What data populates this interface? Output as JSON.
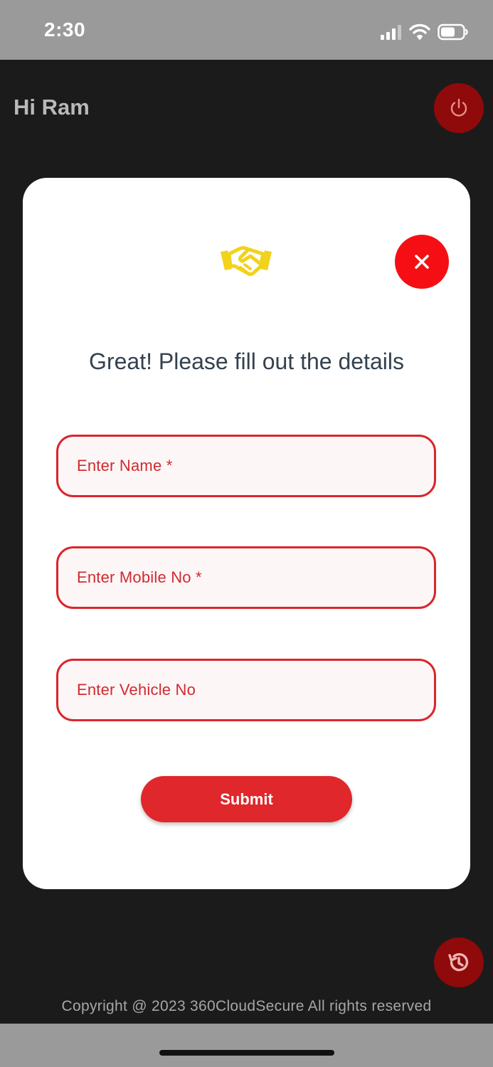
{
  "status_bar": {
    "time": "2:30",
    "icons": [
      "signal-icon",
      "wifi-icon",
      "battery-icon"
    ]
  },
  "header": {
    "greeting": "Hi Ram",
    "power_icon": "power-icon"
  },
  "modal": {
    "icon": "handshake-icon",
    "close_icon": "close-icon",
    "title": "Great! Please fill out the details",
    "fields": [
      {
        "label": "Enter Name *"
      },
      {
        "label": "Enter Mobile No *"
      },
      {
        "label": "Enter Vehicle No"
      }
    ],
    "submit_label": "Submit"
  },
  "footer": {
    "history_icon": "history-icon",
    "copyright": "Copyright @ 2023 360CloudSecure All rights reserved"
  },
  "colors": {
    "accent_red": "#e0272b",
    "dark_red": "#8f0a0a",
    "icon_yellow": "#f2d21b",
    "background": "#1b1b1c"
  }
}
